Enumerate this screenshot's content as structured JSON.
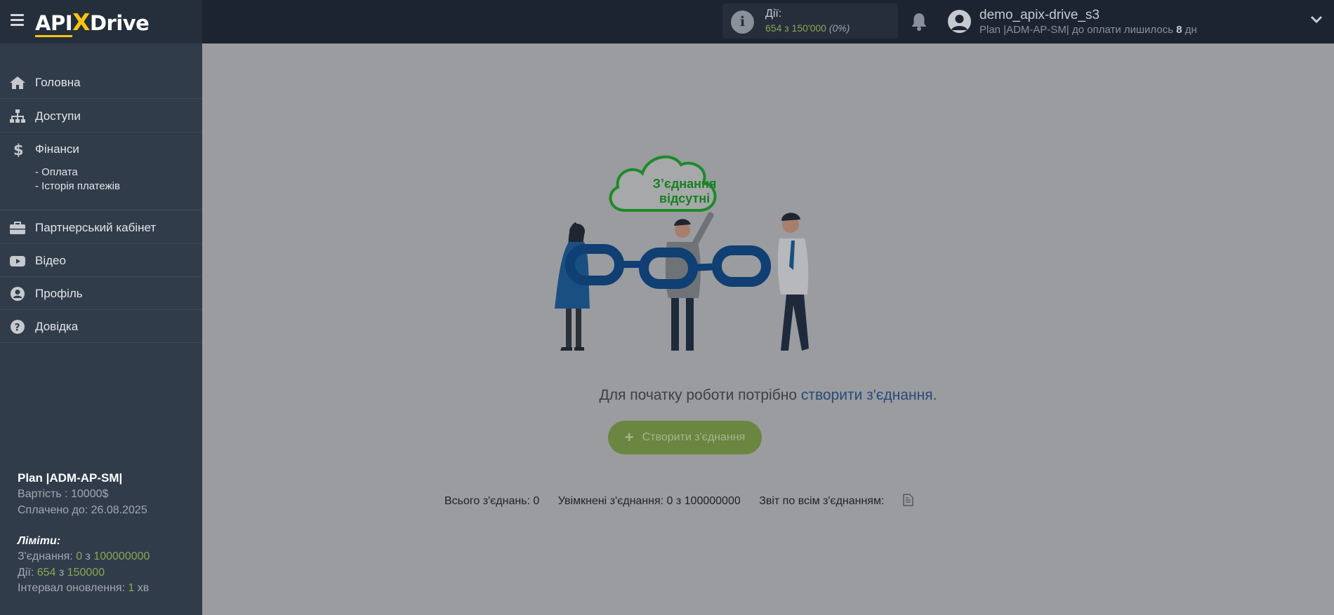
{
  "header": {
    "logo": {
      "part1": "API",
      "x": "X",
      "part2": "Drive"
    },
    "actions": {
      "title": "Дії:",
      "value": "654 з 150'000",
      "percent": "(0%)"
    },
    "user": {
      "name": "demo_apix-drive_s3",
      "plan_prefix": "Plan |ADM-AP-SM| до оплати лишилось ",
      "days": "8",
      "days_unit": " дн"
    }
  },
  "sidebar": {
    "items": [
      {
        "label": "Головна",
        "icon": "home-icon"
      },
      {
        "label": "Доступи",
        "icon": "sitemap-icon"
      },
      {
        "label": "Фінанси",
        "icon": "dollar-icon"
      },
      {
        "label": "Партнерський кабінет",
        "icon": "briefcase-icon"
      },
      {
        "label": "Відео",
        "icon": "youtube-icon"
      },
      {
        "label": "Профіль",
        "icon": "user-circle-icon"
      },
      {
        "label": "Довідка",
        "icon": "question-circle-icon"
      }
    ],
    "finance_sub": [
      "- Оплата",
      "- Історія платежів"
    ],
    "plan": {
      "title": "Plan |ADM-AP-SM|",
      "cost": "Вартість : 10000$",
      "paid_until": "Сплачено до: 26.08.2025"
    },
    "limits": {
      "title": "Ліміти:",
      "connections_label": "З'єднання: ",
      "connections_used": "0",
      "connections_sep": " з ",
      "connections_max": "100000000",
      "actions_label": "Дії: ",
      "actions_used": "654",
      "actions_sep": " з ",
      "actions_max": "150000",
      "interval_label": "Інтервал оновлення: ",
      "interval_value": "1",
      "interval_unit": " хв"
    }
  },
  "main": {
    "cloud_text_1": "З’єднання",
    "cloud_text_2": "відсутні",
    "intro_prefix": "Для початку роботи потрібно ",
    "intro_link": "створити з'єднання",
    "intro_suffix": ".",
    "create_button": "Створити з'єднання",
    "stats": {
      "total": "Всього з'єднань: 0",
      "enabled": "Увімкнені з'єднання: 0 з 100000000",
      "report": "Звіт по всім з'єднанням:"
    }
  },
  "colors": {
    "accent_green": "#87a851",
    "button_green": "#6a8640",
    "link_blue": "#274a7a",
    "logo_yellow": "#f6c510"
  }
}
